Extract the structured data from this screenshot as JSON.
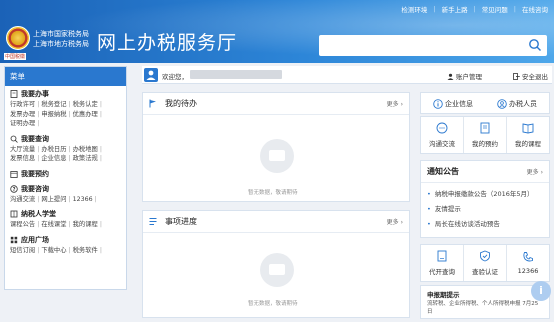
{
  "top_nav": [
    "检测环境",
    "新手上路",
    "常见问题",
    "在线咨询"
  ],
  "brand": {
    "bureau_1": "上海市国家税务局",
    "bureau_2": "上海市地方税务局",
    "site_title": "网上办税服务厅",
    "emblem_caption": "中国税徽"
  },
  "search": {
    "placeholder": ""
  },
  "user_bar": {
    "welcome": "欢迎您，",
    "account": "账户管理",
    "logout": "安全退出"
  },
  "menu": {
    "title": "菜单",
    "sections": [
      {
        "title": "我要办事",
        "links": [
          "行政许可",
          "税务登记",
          "税务认定",
          "发票办理",
          "申报纳税",
          "优惠办理",
          "证明办理"
        ]
      },
      {
        "title": "我要查询",
        "links": [
          "大厅流量",
          "办税日历",
          "办税地图",
          "发票信息",
          "企业信息",
          "政策法规"
        ]
      },
      {
        "title": "我要预约",
        "links": []
      },
      {
        "title": "我要咨询",
        "links": [
          "沟通交流",
          "网上提问",
          "12366"
        ]
      },
      {
        "title": "纳税人学堂",
        "links": [
          "课程公告",
          "在线课堂",
          "我的课程"
        ]
      },
      {
        "title": "应用广场",
        "links": [
          "短信订阅",
          "下载中心",
          "税务软件"
        ]
      }
    ]
  },
  "todo_panel": {
    "title": "我的待办",
    "more": "更多",
    "empty": "暂无数据，敬请期待"
  },
  "progress_panel": {
    "title": "事项进度",
    "more": "更多",
    "empty": "暂无数据，敬请期待"
  },
  "right": {
    "quick": [
      "企业信息",
      "办税人员"
    ],
    "icons_top": [
      "沟通交流",
      "我的预约",
      "我的课程"
    ],
    "notice": {
      "title": "通知公告",
      "more": "更多",
      "items": [
        "纳税申报缴款公告（2016年5月）",
        "友情提示",
        "局长在线访谈活动预告"
      ]
    },
    "icons_bottom": [
      "代开查询",
      "查验认证",
      "12366"
    ],
    "tip": {
      "title": "申报期提示",
      "text": "流转税、企业所得税、个人所得税申报 7月25日"
    }
  },
  "colors": {
    "primary": "#2a78cf",
    "header_start": "#1b62b7",
    "header_end": "#4ea7ea"
  }
}
